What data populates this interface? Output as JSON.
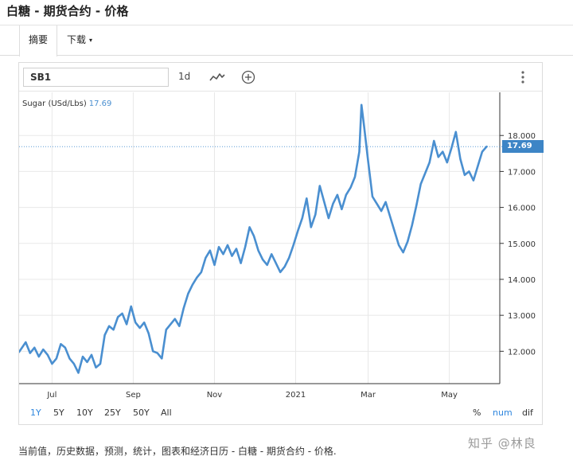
{
  "page": {
    "title": "白糖 - 期货合约 - 价格",
    "tabs": [
      {
        "label": "摘要"
      },
      {
        "label": "下载",
        "caret": "▾"
      }
    ],
    "footer": "当前值，历史数据，预测，统计，图表和经济日历 - 白糖 - 期货合约 - 价格.",
    "watermark": "知乎 @林良"
  },
  "toolbar": {
    "symbol": "SB1",
    "interval": "1d",
    "line_icon": "line-chart-icon",
    "add_icon": "plus-circle-icon",
    "more_icon": "vertical-dots-icon"
  },
  "legend": {
    "label": "Sugar (USd/Lbs)",
    "value": "17.69"
  },
  "ranges": [
    "1Y",
    "5Y",
    "10Y",
    "25Y",
    "50Y",
    "All"
  ],
  "active_range": "1Y",
  "modes": [
    "%",
    "num",
    "dif"
  ],
  "active_mode": "num",
  "colors": {
    "line": "#4a8fd0",
    "flag": "#3d85c6",
    "grid": "#e8e8e8",
    "accent": "#2e86de"
  },
  "chart_data": {
    "type": "line",
    "title": "",
    "xlabel": "",
    "ylabel": "",
    "series": [
      {
        "name": "Sugar (USd/Lbs)",
        "values": [
          [
            0,
            11.98
          ],
          [
            3,
            12.25
          ],
          [
            5,
            11.95
          ],
          [
            7,
            12.1
          ],
          [
            9,
            11.85
          ],
          [
            11,
            12.05
          ],
          [
            13,
            11.9
          ],
          [
            15,
            11.65
          ],
          [
            17,
            11.8
          ],
          [
            19,
            12.2
          ],
          [
            21,
            12.1
          ],
          [
            23,
            11.8
          ],
          [
            25,
            11.65
          ],
          [
            27,
            11.4
          ],
          [
            29,
            11.85
          ],
          [
            31,
            11.7
          ],
          [
            33,
            11.9
          ],
          [
            35,
            11.55
          ],
          [
            37,
            11.65
          ],
          [
            39,
            12.45
          ],
          [
            41,
            12.7
          ],
          [
            43,
            12.6
          ],
          [
            45,
            12.95
          ],
          [
            47,
            13.05
          ],
          [
            49,
            12.75
          ],
          [
            51,
            13.25
          ],
          [
            53,
            12.8
          ],
          [
            55,
            12.65
          ],
          [
            57,
            12.8
          ],
          [
            59,
            12.5
          ],
          [
            61,
            12.0
          ],
          [
            63,
            11.95
          ],
          [
            65,
            11.8
          ],
          [
            67,
            12.6
          ],
          [
            69,
            12.75
          ],
          [
            71,
            12.9
          ],
          [
            73,
            12.7
          ],
          [
            75,
            13.2
          ],
          [
            77,
            13.6
          ],
          [
            79,
            13.85
          ],
          [
            81,
            14.05
          ],
          [
            83,
            14.2
          ],
          [
            85,
            14.6
          ],
          [
            87,
            14.8
          ],
          [
            89,
            14.4
          ],
          [
            91,
            14.9
          ],
          [
            93,
            14.7
          ],
          [
            95,
            14.95
          ],
          [
            97,
            14.65
          ],
          [
            99,
            14.85
          ],
          [
            101,
            14.45
          ],
          [
            103,
            14.9
          ],
          [
            105,
            15.45
          ],
          [
            107,
            15.2
          ],
          [
            109,
            14.8
          ],
          [
            111,
            14.55
          ],
          [
            113,
            14.4
          ],
          [
            115,
            14.7
          ],
          [
            117,
            14.45
          ],
          [
            119,
            14.2
          ],
          [
            121,
            14.35
          ],
          [
            123,
            14.6
          ],
          [
            125,
            14.95
          ],
          [
            127,
            15.35
          ],
          [
            129,
            15.7
          ],
          [
            131,
            16.25
          ],
          [
            133,
            15.45
          ],
          [
            135,
            15.8
          ],
          [
            137,
            16.6
          ],
          [
            139,
            16.15
          ],
          [
            141,
            15.7
          ],
          [
            143,
            16.1
          ],
          [
            145,
            16.35
          ],
          [
            147,
            15.95
          ],
          [
            149,
            16.35
          ],
          [
            151,
            16.55
          ],
          [
            153,
            16.85
          ],
          [
            155,
            17.55
          ],
          [
            156,
            18.85
          ],
          [
            157,
            18.35
          ],
          [
            159,
            17.3
          ],
          [
            161,
            16.3
          ],
          [
            163,
            16.1
          ],
          [
            165,
            15.9
          ],
          [
            167,
            16.15
          ],
          [
            169,
            15.75
          ],
          [
            171,
            15.35
          ],
          [
            173,
            14.95
          ],
          [
            175,
            14.75
          ],
          [
            177,
            15.05
          ],
          [
            179,
            15.5
          ],
          [
            181,
            16.05
          ],
          [
            183,
            16.65
          ],
          [
            185,
            16.95
          ],
          [
            187,
            17.25
          ],
          [
            189,
            17.85
          ],
          [
            191,
            17.4
          ],
          [
            193,
            17.55
          ],
          [
            195,
            17.25
          ],
          [
            197,
            17.65
          ],
          [
            199,
            18.1
          ],
          [
            201,
            17.35
          ],
          [
            203,
            16.9
          ],
          [
            205,
            17.0
          ],
          [
            207,
            16.75
          ],
          [
            209,
            17.15
          ],
          [
            211,
            17.55
          ],
          [
            213,
            17.69
          ]
        ]
      }
    ],
    "ylim": [
      11.1,
      19.2
    ],
    "yticks": [
      "12.000",
      "13.000",
      "14.000",
      "15.000",
      "16.000",
      "17.000",
      "18.000"
    ],
    "xticks": [
      {
        "x": 15,
        "label": "Jul"
      },
      {
        "x": 52,
        "label": "Sep"
      },
      {
        "x": 89,
        "label": "Nov"
      },
      {
        "x": 126,
        "label": "2021"
      },
      {
        "x": 159,
        "label": "Mar"
      },
      {
        "x": 196,
        "label": "May"
      }
    ],
    "xlim": [
      0,
      219
    ],
    "last_value": 17.69,
    "grid": true
  }
}
